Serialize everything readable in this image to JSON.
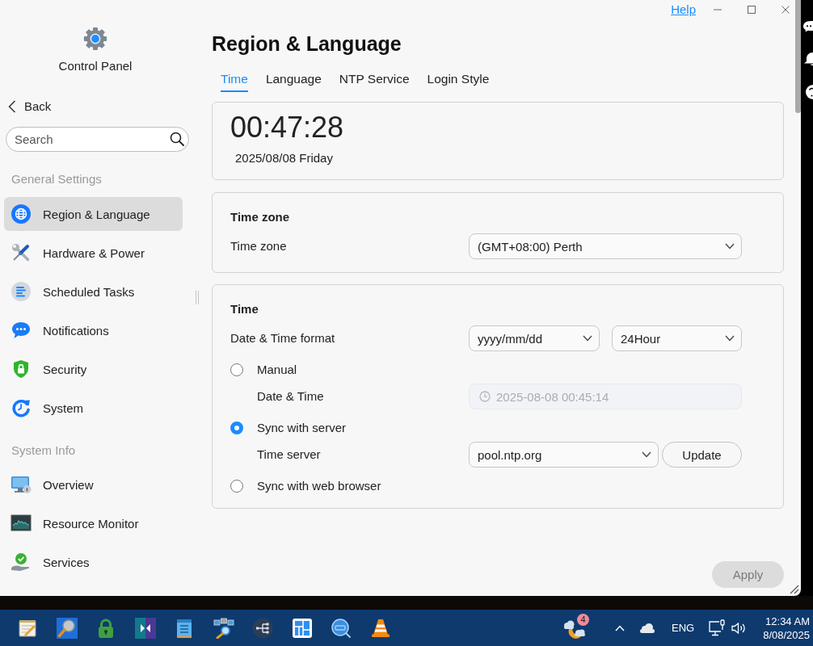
{
  "window": {
    "help_link": "Help"
  },
  "sidebar": {
    "app_title": "Control Panel",
    "back": "Back",
    "search": {
      "placeholder": "Search"
    },
    "sections": [
      {
        "heading": "General Settings",
        "items": [
          {
            "label": "Region & Language",
            "selected": true
          },
          {
            "label": "Hardware & Power",
            "selected": false
          },
          {
            "label": "Scheduled Tasks",
            "selected": false
          },
          {
            "label": "Notifications",
            "selected": false
          },
          {
            "label": "Security",
            "selected": false
          },
          {
            "label": "System",
            "selected": false
          }
        ]
      },
      {
        "heading": "System Info",
        "items": [
          {
            "label": "Overview",
            "selected": false
          },
          {
            "label": "Resource Monitor",
            "selected": false
          },
          {
            "label": "Services",
            "selected": false
          }
        ]
      }
    ]
  },
  "page": {
    "title": "Region & Language",
    "tabs": [
      {
        "label": "Time",
        "selected": true
      },
      {
        "label": "Language",
        "selected": false
      },
      {
        "label": "NTP Service",
        "selected": false
      },
      {
        "label": "Login Style",
        "selected": false
      }
    ]
  },
  "clock_card": {
    "time": "00:47:28",
    "date": "2025/08/08 Friday"
  },
  "time_zone_card": {
    "heading": "Time zone",
    "label": "Time zone",
    "value": "(GMT+08:00) Perth"
  },
  "time_card": {
    "heading": "Time",
    "format_label": "Date & Time format",
    "date_format": "yyyy/mm/dd",
    "hour_format": "24Hour",
    "modes": [
      {
        "label": "Manual",
        "selected": false,
        "setting": {
          "kind": "datetime",
          "label": "Date & Time",
          "value": "2025-08-08 00:45:14",
          "disabled": true
        }
      },
      {
        "label": "Sync with server",
        "selected": true,
        "setting": {
          "kind": "server",
          "label": "Time server",
          "value": "pool.ntp.org",
          "button": "Update"
        }
      },
      {
        "label": "Sync with web browser",
        "selected": false
      }
    ]
  },
  "apply_button": {
    "label": "Apply",
    "disabled": true
  },
  "taskbar": {
    "weather_badge": "4",
    "language": "ENG",
    "time": "12:34 AM",
    "date": "8/08/2025"
  }
}
